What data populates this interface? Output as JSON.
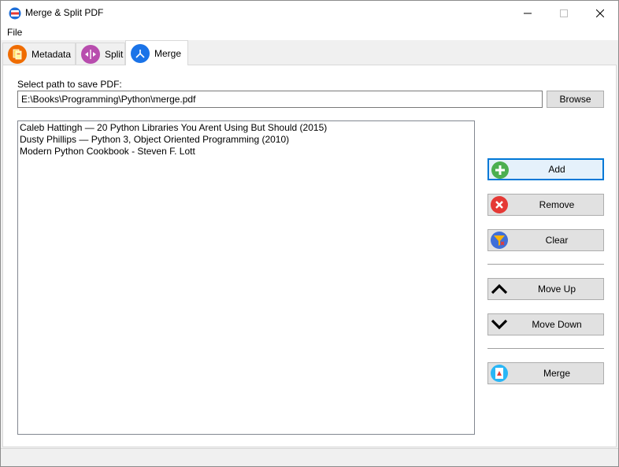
{
  "window": {
    "title": "Merge & Split PDF",
    "icon": "pdf-app-icon",
    "controls": [
      "minimize-icon",
      "maximize-icon",
      "close-icon"
    ]
  },
  "menu": {
    "file_label": "File"
  },
  "tabs": [
    {
      "label": "Metadata",
      "icon": "metadata-icon",
      "active": false
    },
    {
      "label": "Split",
      "icon": "split-icon",
      "active": false
    },
    {
      "label": "Merge",
      "icon": "merge-icon",
      "active": true
    }
  ],
  "merge_tab": {
    "path_label": "Select path to save PDF:",
    "path_value": "E:\\Books\\Programming\\Python\\merge.pdf",
    "browse_label": "Browse",
    "files": [
      "Caleb Hattingh — 20 Python Libraries You Arent Using But Should (2015)",
      "Dusty Phillips — Python 3, Object Oriented Programming (2010)",
      "Modern Python Cookbook - Steven F. Lott"
    ],
    "buttons": {
      "add": "Add",
      "remove": "Remove",
      "clear": "Clear",
      "move_up": "Move Up",
      "move_down": "Move Down",
      "merge": "Merge"
    }
  },
  "colors": {
    "accent": "#0078d7",
    "add_green": "#4caf50",
    "remove_red": "#e53935",
    "split_purple": "#b84dae",
    "merge_blue": "#1a73e8",
    "metadata_orange": "#ef6c00"
  }
}
